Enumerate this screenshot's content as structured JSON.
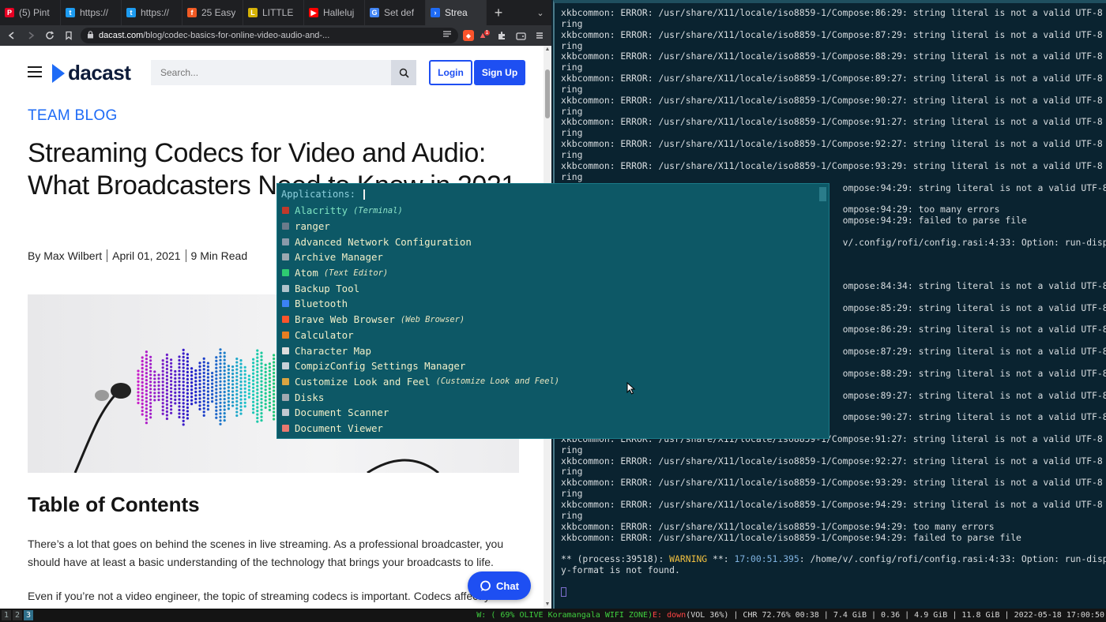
{
  "browser": {
    "tabs": [
      {
        "label": "(5) Pint",
        "icon": "pinterest-icon",
        "color": "#e60023",
        "glyph": "P"
      },
      {
        "label": "https://",
        "icon": "twitter-icon",
        "color": "#1d9bf0",
        "glyph": "t"
      },
      {
        "label": "https://",
        "icon": "twitter-icon",
        "color": "#1d9bf0",
        "glyph": "t"
      },
      {
        "label": "25 Easy",
        "icon": "feather-icon",
        "color": "#f05a24",
        "glyph": "f"
      },
      {
        "label": "LITTLE",
        "icon": "little-icon",
        "color": "#d4b106",
        "glyph": "L"
      },
      {
        "label": "Halleluj",
        "icon": "youtube-icon",
        "color": "#ff0000",
        "glyph": "▶"
      },
      {
        "label": "Set def",
        "icon": "google-icon",
        "color": "#4285f4",
        "glyph": "G"
      },
      {
        "label": "Strea",
        "icon": "dacast-icon",
        "color": "#1e6bf6",
        "glyph": "›",
        "active": true
      }
    ],
    "new_tab": "+",
    "overflow": "⌄",
    "url_domain": "dacast.com",
    "url_path": "/blog/codec-basics-for-online-video-audio-and-...",
    "reward_badge": "1"
  },
  "page": {
    "logo": "dacast",
    "search_placeholder": "Search...",
    "login": "Login",
    "signup": "Sign Up",
    "kicker": "TEAM BLOG",
    "title": "Streaming Codecs for Video and Audio: What Broadcasters Need to Know in 2021",
    "byline": {
      "author": "By Max Wilbert",
      "date": "April 01, 2021",
      "read_time": "9 Min Read"
    },
    "toc_title": "Table of Contents",
    "para1": "There’s a lot that goes on behind the scenes in live streaming. As a professional broadcaster, you should have at least a basic understanding of the technology that brings your broadcasts to life.",
    "para2": "Even if you’re not a video engineer, the topic of streaming codecs is important. Codecs affect your",
    "chat": "Chat"
  },
  "terminal": {
    "lines": [
      "xkbcommon: ERROR: /usr/share/X11/locale/iso8859-1/Compose:86:29: string literal is not a valid UTF-8 st",
      "ring",
      "xkbcommon: ERROR: /usr/share/X11/locale/iso8859-1/Compose:87:29: string literal is not a valid UTF-8 st",
      "ring",
      "xkbcommon: ERROR: /usr/share/X11/locale/iso8859-1/Compose:88:29: string literal is not a valid UTF-8 st",
      "ring",
      "xkbcommon: ERROR: /usr/share/X11/locale/iso8859-1/Compose:89:27: string literal is not a valid UTF-8 st",
      "ring",
      "xkbcommon: ERROR: /usr/share/X11/locale/iso8859-1/Compose:90:27: string literal is not a valid UTF-8 st",
      "ring",
      "xkbcommon: ERROR: /usr/share/X11/locale/iso8859-1/Compose:91:27: string literal is not a valid UTF-8 st",
      "ring",
      "xkbcommon: ERROR: /usr/share/X11/locale/iso8859-1/Compose:92:27: string literal is not a valid UTF-8 st",
      "ring",
      "xkbcommon: ERROR: /usr/share/X11/locale/iso8859-1/Compose:93:29: string literal is not a valid UTF-8 st",
      "ring",
      "                                                    ompose:94:29: string literal is not a valid UTF-8 st",
      "",
      "                                                    ompose:94:29: too many errors",
      "                                                    ompose:94:29: failed to parse file",
      "",
      "                                                    v/.config/rofi/config.rasi:4:33: Option: run-displa",
      "",
      "",
      "",
      "                                                    ompose:84:34: string literal is not a valid UTF-8 st",
      "",
      "                                                    ompose:85:29: string literal is not a valid UTF-8 st",
      "",
      "                                                    ompose:86:29: string literal is not a valid UTF-8 st",
      "",
      "                                                    ompose:87:29: string literal is not a valid UTF-8 st",
      "",
      "                                                    ompose:88:29: string literal is not a valid UTF-8 st",
      "",
      "                                                    ompose:89:27: string literal is not a valid UTF-8 st",
      "",
      "                                                    ompose:90:27: string literal is not a valid UTF-8 st",
      "",
      "xkbcommon: ERROR: /usr/share/X11/locale/iso8859-1/Compose:91:27: string literal is not a valid UTF-8 st",
      "ring",
      "xkbcommon: ERROR: /usr/share/X11/locale/iso8859-1/Compose:92:27: string literal is not a valid UTF-8 st",
      "ring",
      "xkbcommon: ERROR: /usr/share/X11/locale/iso8859-1/Compose:93:29: string literal is not a valid UTF-8 st",
      "ring",
      "xkbcommon: ERROR: /usr/share/X11/locale/iso8859-1/Compose:94:29: string literal is not a valid UTF-8 st",
      "ring",
      "xkbcommon: ERROR: /usr/share/X11/locale/iso8859-1/Compose:94:29: too many errors",
      "xkbcommon: ERROR: /usr/share/X11/locale/iso8859-1/Compose:94:29: failed to parse file",
      ""
    ],
    "warn_prefix": "** (process:39518): ",
    "warn_word": "WARNING",
    "warn_mid": " **: ",
    "warn_time": "17:00:51.395",
    "warn_rest": ": /home/v/.config/rofi/config.rasi:4:33: Option: run-displa",
    "warn_cont": "y-format is not found."
  },
  "rofi": {
    "prompt": "Applications:",
    "items": [
      {
        "name": "Alacritty",
        "generic": "(Terminal)",
        "icon_color": "#c0392b",
        "selected": true
      },
      {
        "name": "ranger",
        "generic": "",
        "icon_color": "#6b7b8b"
      },
      {
        "name": "Advanced Network Configuration",
        "generic": "",
        "icon_color": "#8a9aaa"
      },
      {
        "name": "Archive Manager",
        "generic": "",
        "icon_color": "#9aa8b0"
      },
      {
        "name": "Atom",
        "generic": "(Text Editor)",
        "icon_color": "#2ecc71"
      },
      {
        "name": "Backup Tool",
        "generic": "",
        "icon_color": "#b0c4cc"
      },
      {
        "name": "Bluetooth",
        "generic": "",
        "icon_color": "#3b82f6"
      },
      {
        "name": "Brave Web Browser",
        "generic": "(Web Browser)",
        "icon_color": "#fb542b"
      },
      {
        "name": "Calculator",
        "generic": "",
        "icon_color": "#e67e22"
      },
      {
        "name": "Character Map",
        "generic": "",
        "icon_color": "#dddddd"
      },
      {
        "name": "CompizConfig Settings Manager",
        "generic": "",
        "icon_color": "#c8d0d8"
      },
      {
        "name": "Customize Look and Feel",
        "generic": "(Customize Look and Feel)",
        "icon_color": "#d9a441"
      },
      {
        "name": "Disks",
        "generic": "",
        "icon_color": "#a0a8b0"
      },
      {
        "name": "Document Scanner",
        "generic": "",
        "icon_color": "#c0c8d0"
      },
      {
        "name": "Document Viewer",
        "generic": "",
        "icon_color": "#e8786f"
      }
    ]
  },
  "statusbar": {
    "workspaces": [
      {
        "label": "1"
      },
      {
        "label": "2"
      },
      {
        "label": "3",
        "active": true
      }
    ],
    "wifi": "W: ( 69% OLIVE Koramangala WIFI ZONE) ",
    "eth": "E: down",
    "rest": " (VOL 36%) | CHR 72.76% 00:38 | 7.4 GiB | 0.36 | 4.9 GiB | 11.8 GiB | 2022-05-18 17:00:50"
  }
}
